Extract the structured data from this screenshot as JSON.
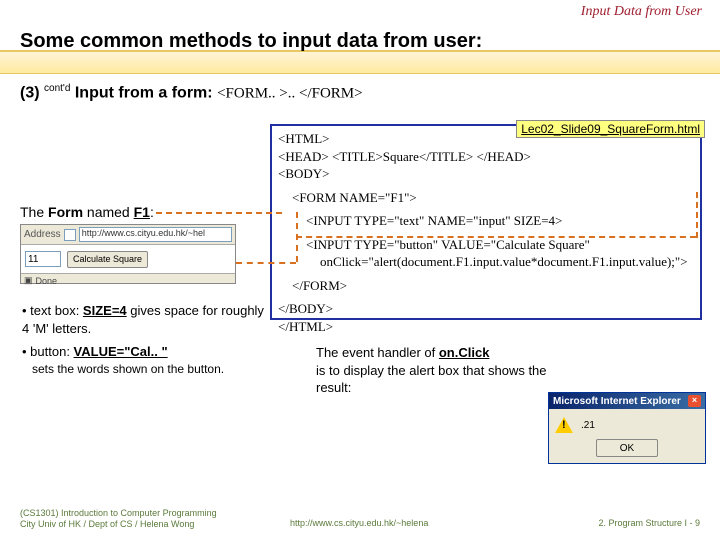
{
  "header": {
    "top_right": "Input Data from User",
    "title": "Some common methods to input data from user:"
  },
  "subhead": {
    "num": "(3)",
    "contd": "cont'd",
    "text": "Input from a form:",
    "form_tag": "<FORM.. >.. </FORM>"
  },
  "file_label": "Lec02_Slide09_SquareForm.html",
  "code": {
    "l1": "<HTML>",
    "l2": "<HEAD> <TITLE>Square</TITLE> </HEAD>",
    "l3": "<BODY>",
    "l4": "<FORM NAME=\"F1\">",
    "l5": "<INPUT TYPE=\"text\" NAME=\"input\" SIZE=4>",
    "l6": "<INPUT TYPE=\"button\" VALUE=\"Calculate Square\"",
    "l7": "onClick=\"alert(document.F1.input.value*document.F1.input.value);\">",
    "l8": "</FORM>",
    "l9": "</BODY>",
    "l10": "</HTML>"
  },
  "form_label": {
    "pre": "The ",
    "bold1": "Form",
    "mid": " named ",
    "bold2": "F1",
    "post": ":"
  },
  "browser": {
    "addr_label": "Address",
    "addr_url": "http://www.cs.cityu.edu.hk/~hel",
    "input_value": "11",
    "button_label": "Calculate Square",
    "status": "Done"
  },
  "bullets": {
    "b1_pre": "text box: ",
    "b1_bold": "SIZE=4",
    "b1_post": " gives space for roughly 4 'M' letters.",
    "b2_pre": "button: ",
    "b2_bold": "VALUE=\"Cal.. \"",
    "b2_sub": "sets the words shown on the button."
  },
  "right_text": {
    "l1_a": "The event handler of ",
    "l1_b": "on.Click",
    "l2": "is to display the alert box that shows the result:"
  },
  "alert": {
    "title": "Microsoft Internet Explorer",
    "msg": ".21",
    "ok": "OK"
  },
  "footer": {
    "left1": "(CS1301) Introduction to Computer Programming",
    "left2": "City Univ of HK / Dept of CS / Helena Wong",
    "mid": "http://www.cs.cityu.edu.hk/~helena",
    "right": "2. Program Structure I - 9"
  }
}
